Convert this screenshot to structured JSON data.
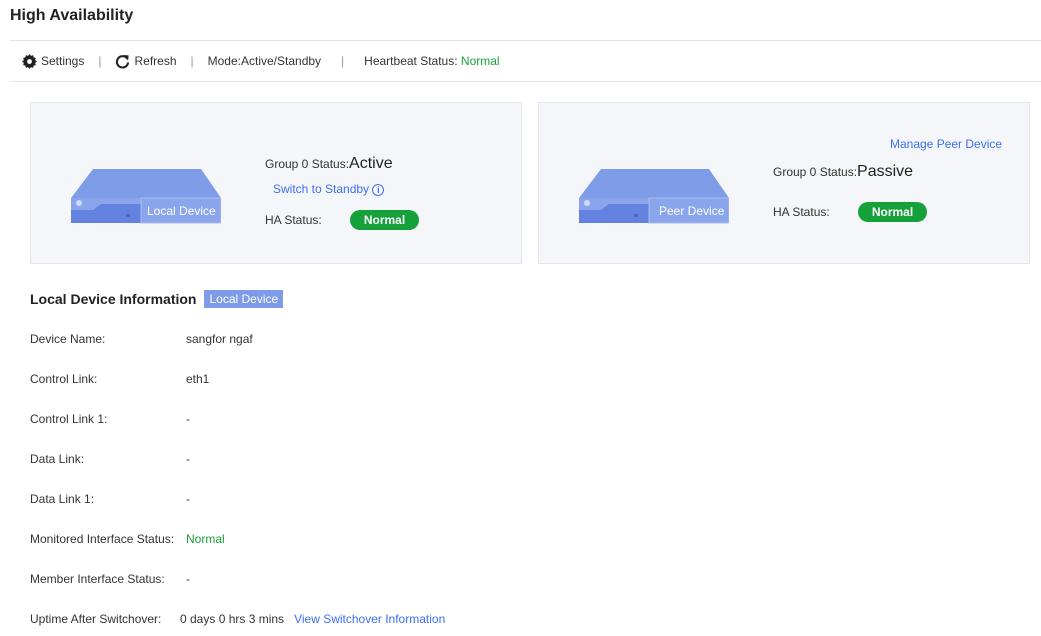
{
  "title": "High Availability",
  "toolbar": {
    "settings": "Settings",
    "refresh": "Refresh",
    "mode": "Mode:Active/Standby",
    "heartbeat_label": "Heartbeat Status:",
    "heartbeat_value": "Normal"
  },
  "local": {
    "device_label": "Local Device",
    "group_label": "Group 0 Status:",
    "group_value": "Active",
    "switch_link": "Switch to Standby",
    "ha_label": "HA Status:",
    "ha_value": "Normal"
  },
  "peer": {
    "manage_link": "Manage Peer Device",
    "device_label": "Peer Device",
    "group_label": "Group 0 Status:",
    "group_value": "Passive",
    "ha_label": "HA Status:",
    "ha_value": "Normal"
  },
  "info": {
    "title": "Local Device Information",
    "tag": "Local Device",
    "rows": [
      {
        "label": "Device Name:",
        "value": "sangfor ngaf"
      },
      {
        "label": "Control Link:",
        "value": "eth1"
      },
      {
        "label": "Control Link 1:",
        "value": "-"
      },
      {
        "label": "Data Link:",
        "value": "-"
      },
      {
        "label": "Data Link 1:",
        "value": "-"
      },
      {
        "label": "Monitored Interface Status:",
        "value": "Normal"
      },
      {
        "label": "Member Interface Status:",
        "value": "-"
      }
    ],
    "uptime_label": "Uptime After Switchover:",
    "uptime_value": "0 days 0 hrs 3 mins",
    "uptime_link": "View Switchover Information"
  },
  "colors": {
    "accent": "#3d6ff0",
    "ok": "#15a03a",
    "device": "#7d9be8"
  }
}
